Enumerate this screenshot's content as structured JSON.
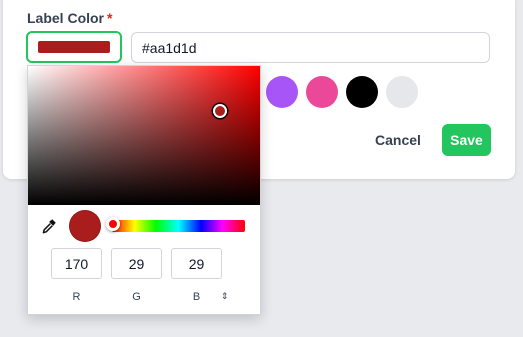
{
  "form": {
    "label": "Label Color",
    "required_mark": "*",
    "hex_value": "#aa1d1d",
    "selected_color": "#aa1d1d",
    "cancel_label": "Cancel",
    "save_label": "Save"
  },
  "presets": [
    {
      "name": "purple",
      "color": "#a855f7"
    },
    {
      "name": "pink",
      "color": "#ec4899"
    },
    {
      "name": "black",
      "color": "#000000"
    },
    {
      "name": "light-gray",
      "color": "#e5e7eb"
    }
  ],
  "picker": {
    "hue_color": "#ff0000",
    "channels": [
      {
        "label": "R",
        "value": "170"
      },
      {
        "label": "G",
        "value": "29"
      },
      {
        "label": "B",
        "value": "29"
      }
    ],
    "mode_toggle": "⇕"
  },
  "colors": {
    "accent": "#22c55e",
    "required": "#dc2626"
  }
}
